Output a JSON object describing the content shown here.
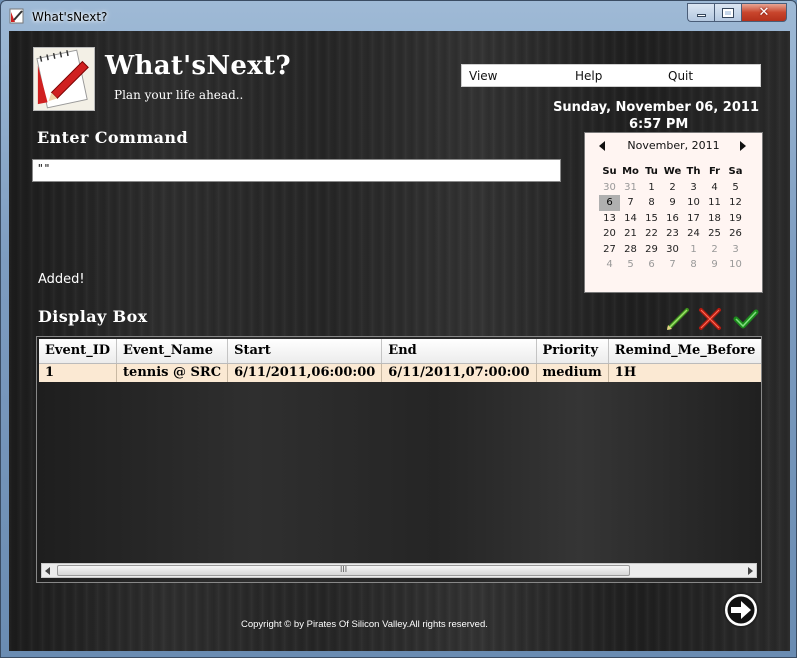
{
  "window": {
    "title": "What'sNext?",
    "close_glyph": "✕"
  },
  "app": {
    "title": "What'sNext?",
    "tagline": "Plan your life ahead.."
  },
  "menu": {
    "items": [
      "View",
      "Help",
      "Quit"
    ]
  },
  "datetime": {
    "date": "Sunday, November 06, 2011",
    "time": "6:57 PM"
  },
  "command": {
    "heading": "Enter Command",
    "value": "\"\"",
    "status": "Added!"
  },
  "calendar": {
    "month_label": "November, 2011",
    "weekdays": [
      "Su",
      "Mo",
      "Tu",
      "We",
      "Th",
      "Fr",
      "Sa"
    ],
    "weeks": [
      [
        "30",
        "31",
        "1",
        "2",
        "3",
        "4",
        "5"
      ],
      [
        "6",
        "7",
        "8",
        "9",
        "10",
        "11",
        "12"
      ],
      [
        "13",
        "14",
        "15",
        "16",
        "17",
        "18",
        "19"
      ],
      [
        "20",
        "21",
        "22",
        "23",
        "24",
        "25",
        "26"
      ],
      [
        "27",
        "28",
        "29",
        "30",
        "1",
        "2",
        "3"
      ],
      [
        "4",
        "5",
        "6",
        "7",
        "8",
        "9",
        "10"
      ]
    ],
    "selected": "6"
  },
  "display_box": {
    "heading": "Display Box",
    "columns": [
      "Event_ID",
      "Event_Name",
      "Start",
      "End",
      "Priority",
      "Remind_Me_Before"
    ],
    "rows": [
      [
        "1",
        "tennis @ SRC",
        "6/11/2011,06:00:00",
        "6/11/2011,07:00:00",
        "medium",
        "1H"
      ]
    ],
    "scroll_grip": "III"
  },
  "footer": {
    "copyright": "Copyright © by Pirates Of Silicon Valley.All rights reserved."
  },
  "colors": {
    "row_highlight": "#fbe9d3",
    "close_button": "#c8452c",
    "calendar_bg": "#fff5f2"
  }
}
